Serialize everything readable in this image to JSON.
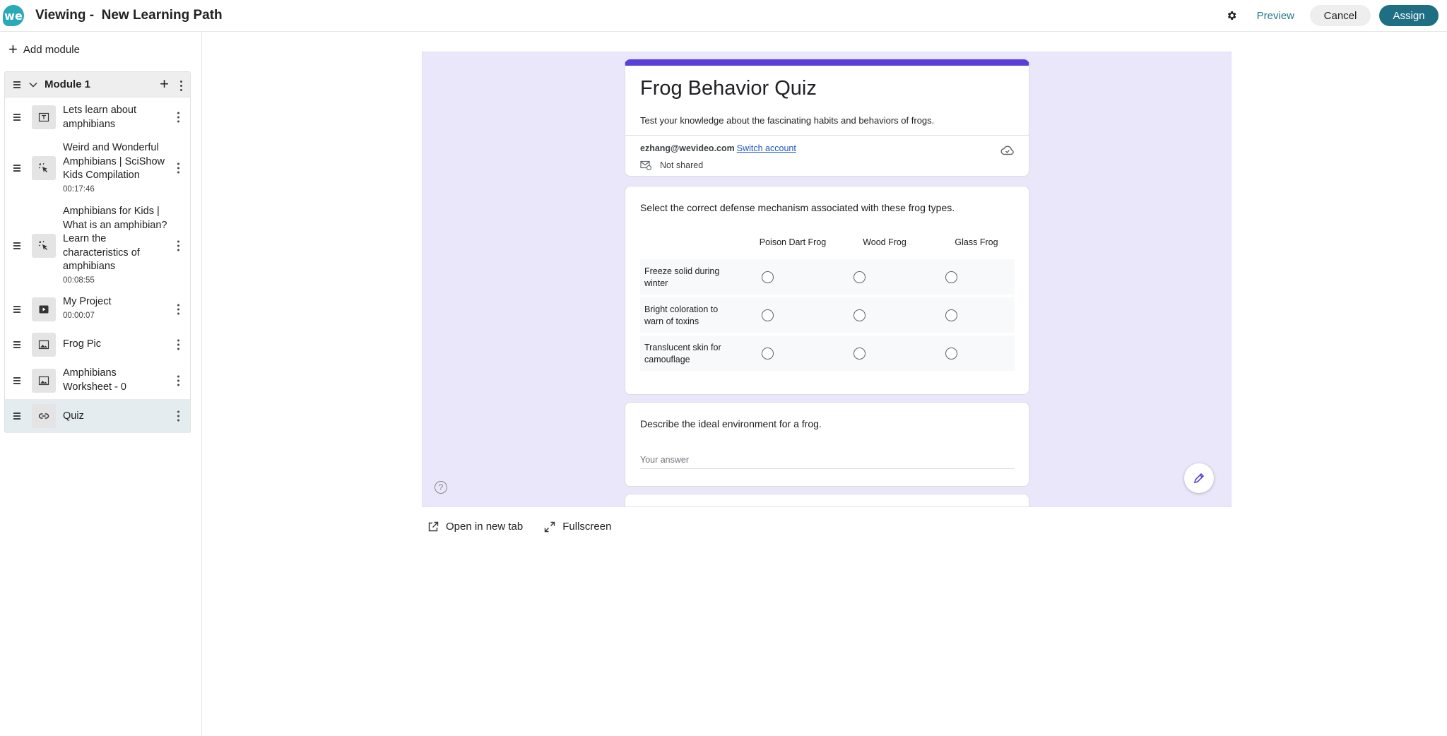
{
  "header": {
    "title": "Viewing -  New Learning Path",
    "logo_text": "we",
    "preview_label": "Preview",
    "cancel_label": "Cancel",
    "assign_label": "Assign"
  },
  "sidebar": {
    "add_module_label": "Add module",
    "module": {
      "title": "Module 1",
      "items": [
        {
          "label": "Lets learn about amphibians",
          "time": "",
          "icon": "text-icon"
        },
        {
          "label": "Weird and Wonderful Amphibians | SciShow Kids Compilation",
          "time": "00:17:46",
          "icon": "interactive-video-icon"
        },
        {
          "label": "Amphibians for Kids | What is an amphibian? Learn the characteristics of amphibians",
          "time": "00:08:55",
          "icon": "interactive-video-icon"
        },
        {
          "label": "My Project",
          "time": "00:00:07",
          "icon": "video-icon"
        },
        {
          "label": "Frog Pic",
          "time": "",
          "icon": "image-icon"
        },
        {
          "label": "Amphibians Worksheet - 0",
          "time": "",
          "icon": "image-icon"
        },
        {
          "label": "Quiz",
          "time": "",
          "icon": "link-icon"
        }
      ]
    }
  },
  "form": {
    "title": "Frog Behavior Quiz",
    "description": "Test your knowledge about the fascinating habits and behaviors of frogs.",
    "account_email": "ezhang@wevideo.com",
    "switch_account_label": "Switch account",
    "share_status": "Not shared",
    "grid_question": {
      "text": "Select the correct defense mechanism associated with these frog types.",
      "columns": [
        "Poison Dart Frog",
        "Wood Frog",
        "Glass Frog"
      ],
      "rows": [
        "Freeze solid during winter",
        "Bright coloration to warn of toxins",
        "Translucent skin for camouflage"
      ]
    },
    "text_question": {
      "text": "Describe the ideal environment for a frog.",
      "placeholder": "Your answer"
    }
  },
  "footer_links": {
    "open_new_tab": "Open in new tab",
    "fullscreen": "Fullscreen"
  },
  "colors": {
    "accent": "#1f6f84",
    "form_header": "#5a3fd9",
    "form_background": "#ebe7fb",
    "selected_item": "#e5ecef"
  }
}
